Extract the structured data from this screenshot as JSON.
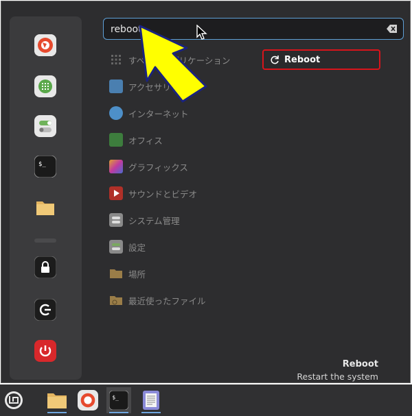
{
  "search": {
    "value": "reboot",
    "placeholder": ""
  },
  "categories": [
    {
      "id": "all",
      "label": "すべてのアプリケーション",
      "color": "#555"
    },
    {
      "id": "accessories",
      "label": "アクセサリ",
      "color": "#4a7fb0"
    },
    {
      "id": "internet",
      "label": "インターネット",
      "color": "#4d8fc8"
    },
    {
      "id": "office",
      "label": "オフィス",
      "color": "#3d7d3d"
    },
    {
      "id": "graphics",
      "label": "グラフィックス",
      "color": "#b04ab0"
    },
    {
      "id": "sound",
      "label": "サウンドとビデオ",
      "color": "#c0392b"
    },
    {
      "id": "system",
      "label": "システム管理",
      "color": "#777"
    },
    {
      "id": "settings",
      "label": "設定",
      "color": "#777"
    },
    {
      "id": "places",
      "label": "場所",
      "color": "#a0824a"
    },
    {
      "id": "recent",
      "label": "最近使ったファイル",
      "color": "#a0824a"
    }
  ],
  "result": {
    "label": "Reboot",
    "icon": "reboot-icon"
  },
  "description": {
    "title": "Reboot",
    "subtitle": "Restart the system"
  },
  "favorites": [
    "firefox-icon",
    "calculator-icon",
    "settings-toggle-icon",
    "terminal-icon",
    "folder-icon",
    "lock-icon",
    "logout-icon",
    "power-icon"
  ],
  "taskbar": [
    "mint-menu-icon",
    "files-icon",
    "firefox-icon",
    "terminal-icon",
    "text-editor-icon"
  ],
  "colors": {
    "accent": "#5fa1d8",
    "highlight": "#d9141b",
    "annotation": "#ffff00"
  }
}
